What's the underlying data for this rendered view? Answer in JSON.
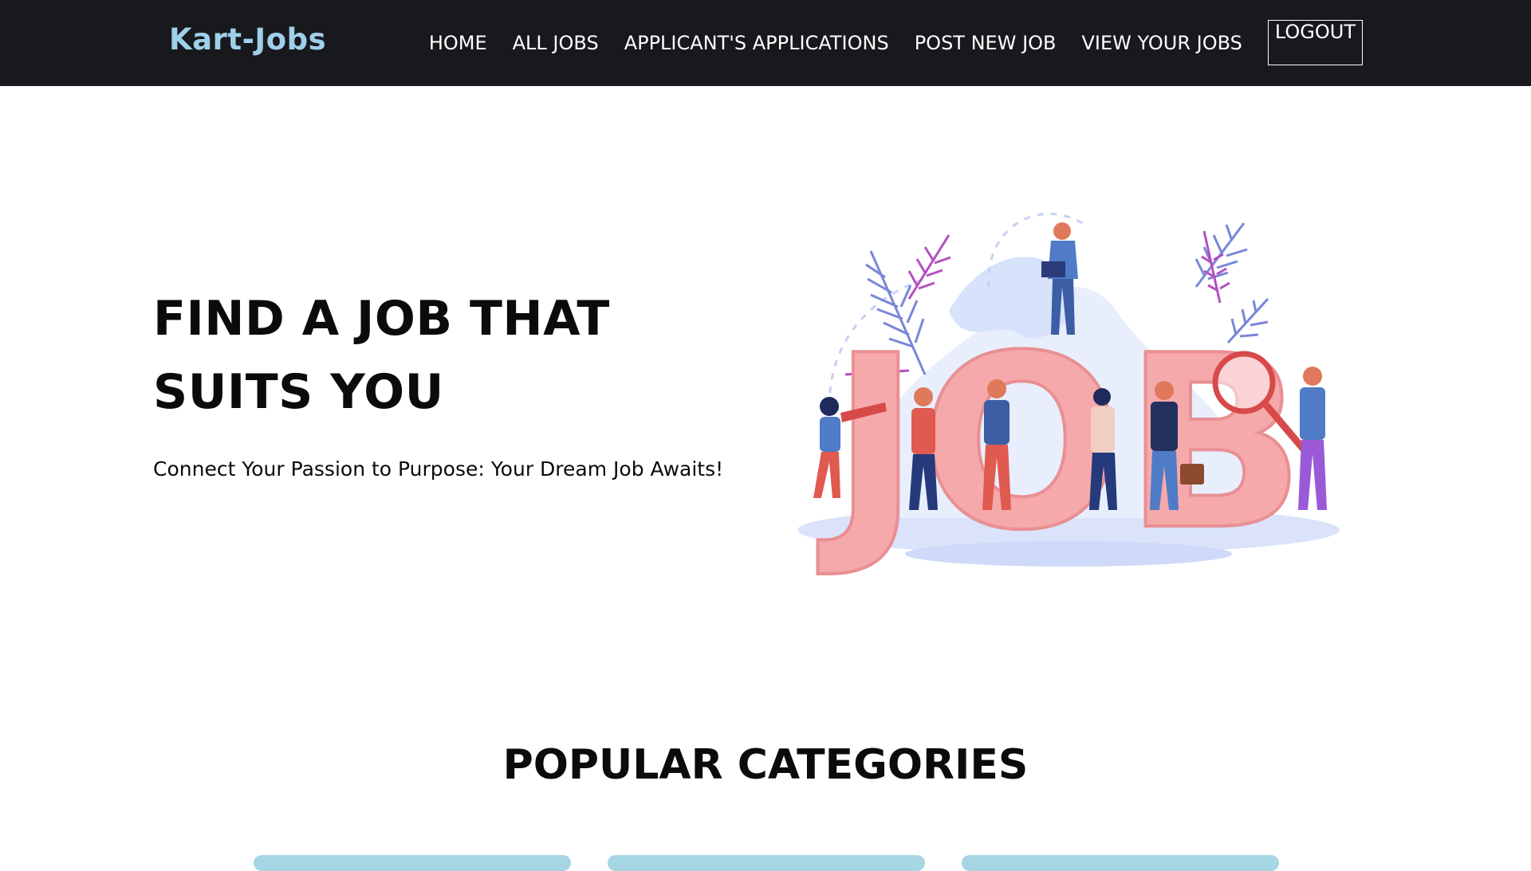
{
  "brand": {
    "name": "Kart-Jobs"
  },
  "nav": {
    "items": [
      "HOME",
      "ALL JOBS",
      "APPLICANT'S APPLICATIONS",
      "POST NEW JOB",
      "VIEW YOUR JOBS"
    ],
    "logout_label": "LOGOUT"
  },
  "hero": {
    "title": "FIND A JOB THAT SUITS YOU",
    "subtitle": "Connect Your Passion to Purpose: Your Dream Job Awaits!",
    "illustration_text": "JOB"
  },
  "categories": {
    "heading": "POPULAR CATEGORIES"
  },
  "colors": {
    "nav_bg": "#18191d",
    "brand": "#9fd0ea",
    "letters": "#f5a9aa",
    "card": "#a6d6e3"
  }
}
